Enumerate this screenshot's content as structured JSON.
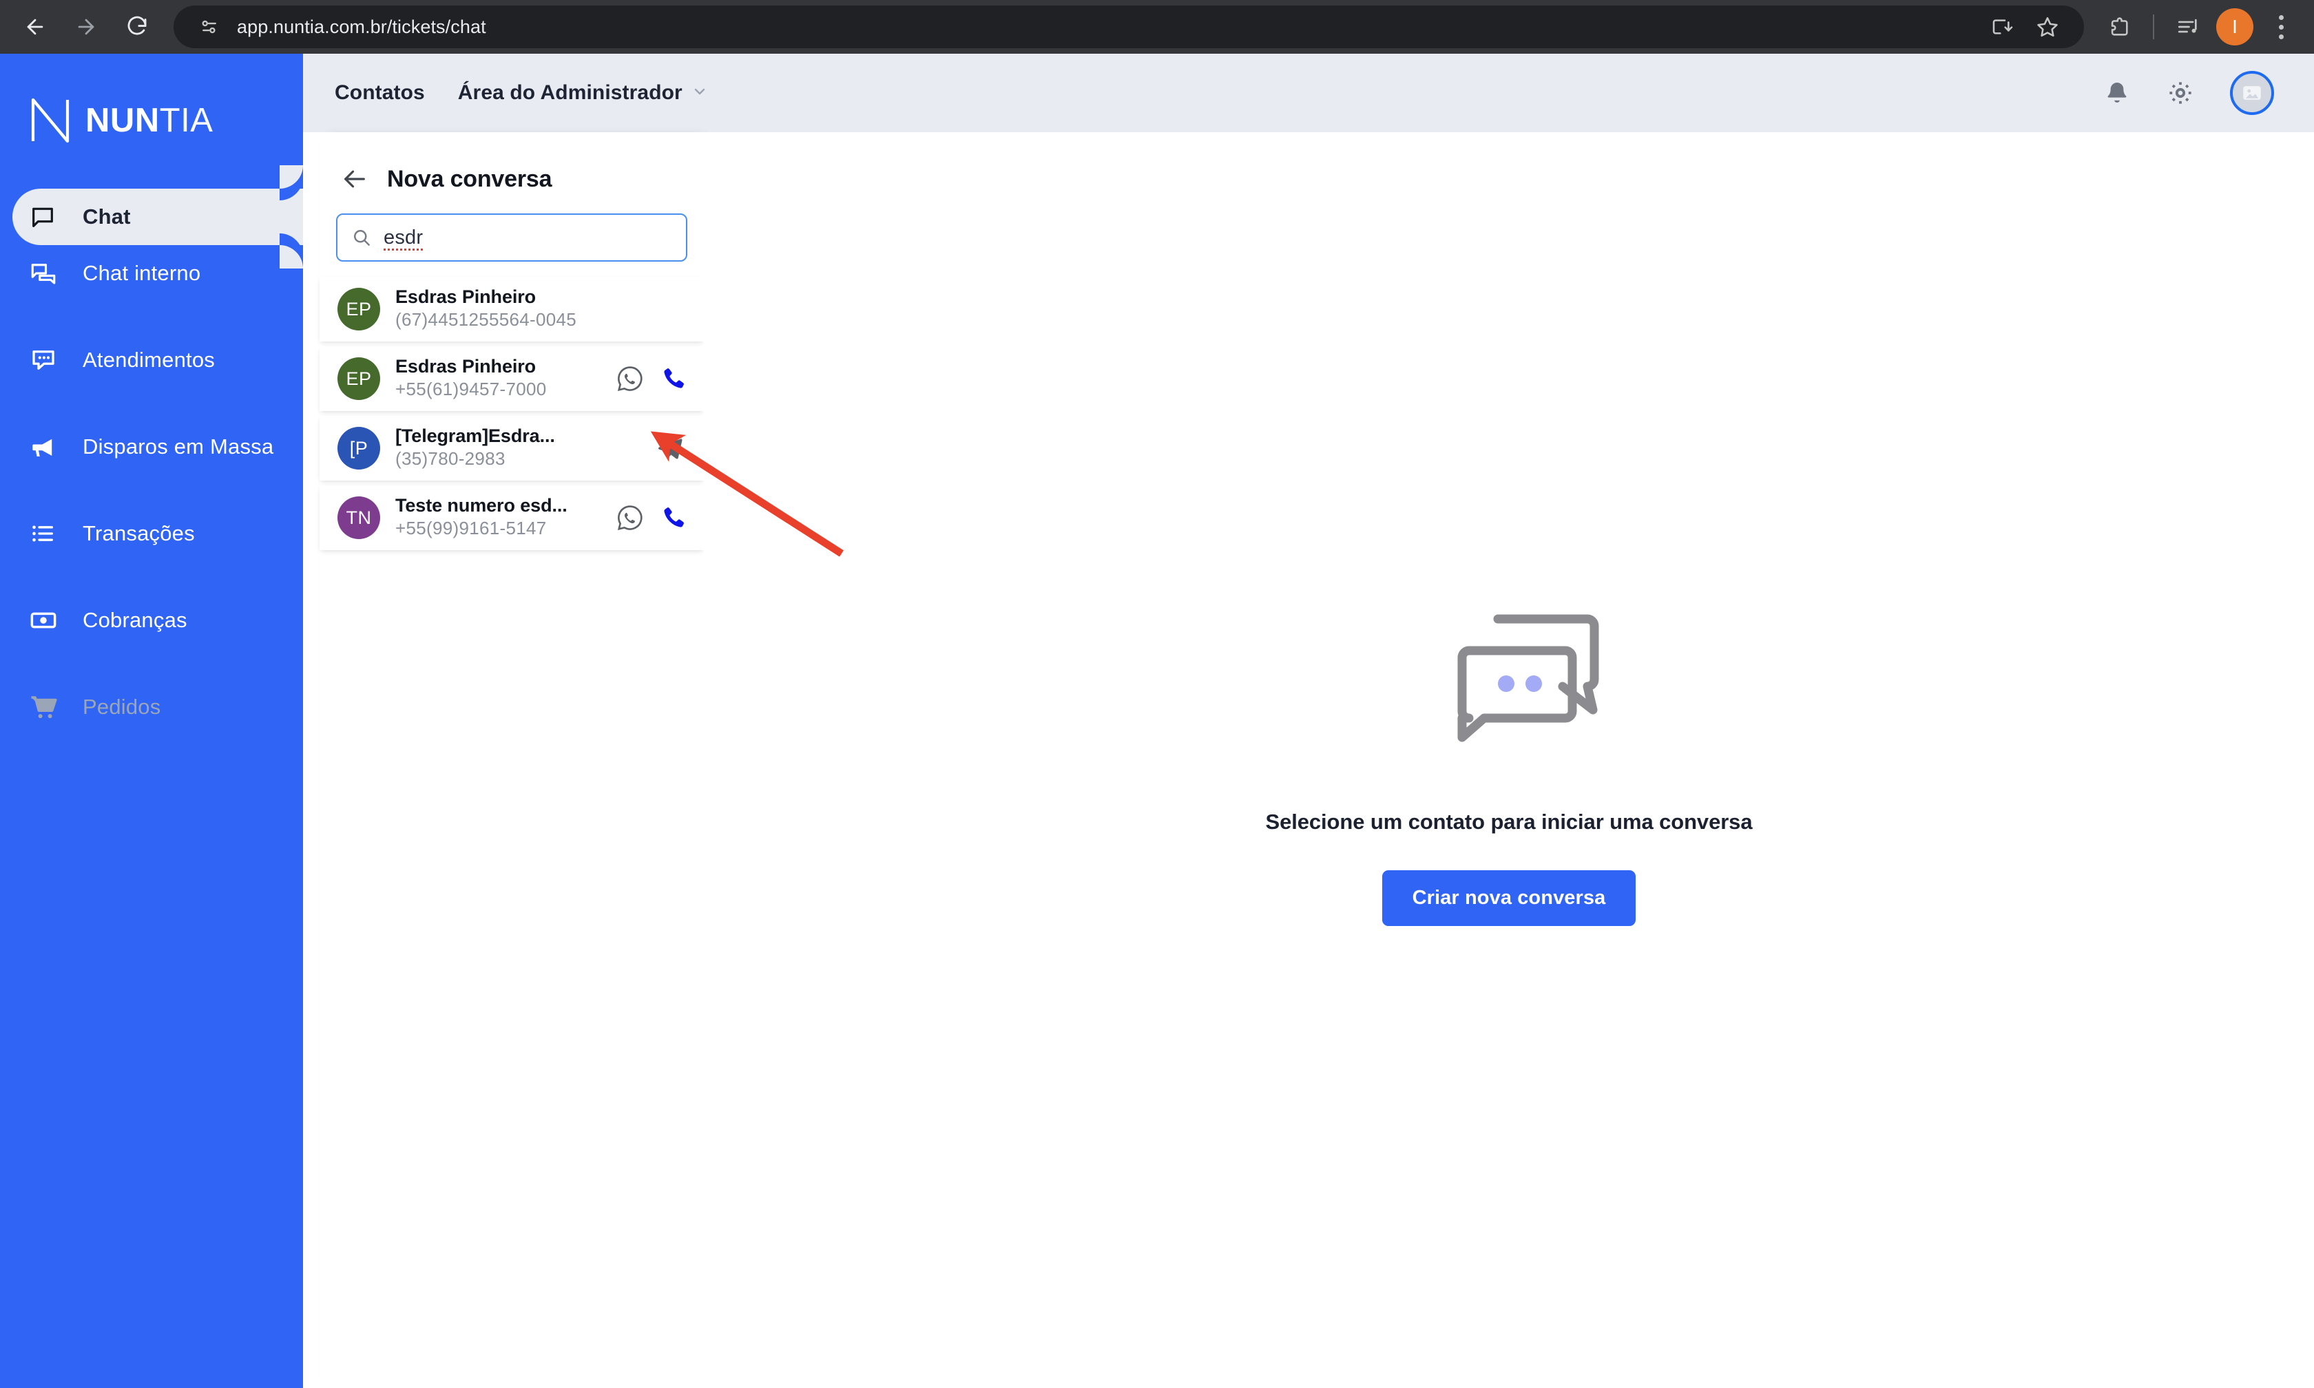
{
  "browser": {
    "url": "app.nuntia.com.br/tickets/chat",
    "back_label": "Back",
    "forward_label": "Forward",
    "reload_label": "Reload",
    "site_info_label": "View site information",
    "install_label": "Install",
    "bookmark_label": "Bookmark this tab",
    "extensions_label": "Extensions",
    "media_label": "Media controls",
    "profile_initial": "I",
    "menu_label": "Customize and control Chrome"
  },
  "sidebar": {
    "logo": {
      "bold": "NUN",
      "light": "TIA"
    },
    "items": [
      {
        "label": "Chat",
        "icon": "chat-bubble-icon",
        "active": true,
        "disabled": false
      },
      {
        "label": "Chat interno",
        "icon": "chat-bubbles-icon",
        "active": false,
        "disabled": false
      },
      {
        "label": "Atendimentos",
        "icon": "chat-dots-icon",
        "active": false,
        "disabled": false
      },
      {
        "label": "Disparos em Massa",
        "icon": "megaphone-icon",
        "active": false,
        "disabled": false
      },
      {
        "label": "Transações",
        "icon": "list-icon",
        "active": false,
        "disabled": false
      },
      {
        "label": "Cobranças",
        "icon": "banknote-icon",
        "active": false,
        "disabled": false
      },
      {
        "label": "Pedidos",
        "icon": "cart-icon",
        "active": false,
        "disabled": true
      }
    ]
  },
  "topbar": {
    "contacts_label": "Contatos",
    "admin_label": "Área do Administrador",
    "notifications_label": "Notificações",
    "settings_label": "Configurações",
    "avatar_label": "Perfil"
  },
  "panel": {
    "title": "Nova conversa",
    "back_label": "Voltar",
    "search": {
      "value": "esdr",
      "placeholder": "Pesquisar"
    },
    "contacts": [
      {
        "initials": "EP",
        "name": "Esdras Pinheiro",
        "phone": "(67)4451255564-0045",
        "avatar_color": "#466a2c",
        "channels": []
      },
      {
        "initials": "EP",
        "name": "Esdras Pinheiro",
        "phone": "+55(61)9457-7000",
        "avatar_color": "#466a2c",
        "channels": [
          "whatsapp-icon",
          "phone-icon"
        ]
      },
      {
        "initials": "[P",
        "name": "[Telegram]Esdra...",
        "phone": "(35)780-2983",
        "avatar_color": "#2a55b5",
        "channels": [
          "telegram-icon"
        ]
      },
      {
        "initials": "TN",
        "name": "Teste numero esd...",
        "phone": "+55(99)9161-5147",
        "avatar_color": "#7d3c8e",
        "channels": [
          "whatsapp-icon",
          "phone-icon"
        ]
      }
    ]
  },
  "main": {
    "empty_message": "Selecione um contato para iniciar uma conversa",
    "cta_label": "Criar nova conversa",
    "illustration": "chat-bubbles-illustration"
  },
  "annotation": {
    "type": "arrow",
    "color": "#e8402a",
    "points_to": "whatsapp-icon of contact row 2"
  },
  "colors": {
    "brand_blue": "#2f64f4",
    "header_bg": "#e8ebf2",
    "chrome_bg": "#35363a",
    "omnibox_bg": "#202124",
    "annotation_red": "#e8402a"
  }
}
